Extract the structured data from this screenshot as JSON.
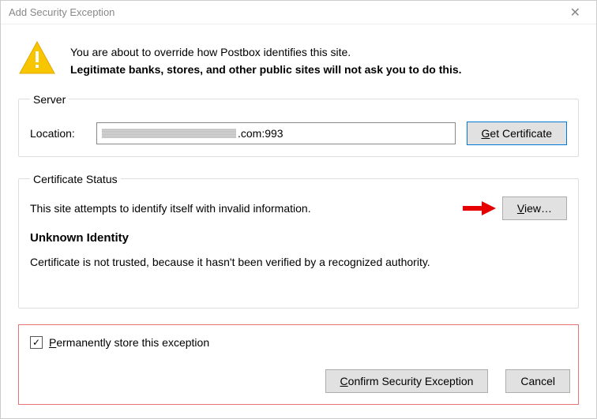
{
  "window": {
    "title": "Add Security Exception"
  },
  "intro": {
    "line1": "You are about to override how Postbox identifies this site.",
    "line2": "Legitimate banks, stores, and other public sites will not ask you to do this."
  },
  "server": {
    "legend": "Server",
    "location_label": "Location:",
    "location_suffix": ".com:993",
    "get_certificate_label": "Get Certificate",
    "get_certificate_accesskey": "G"
  },
  "cert": {
    "legend": "Certificate Status",
    "attempt_text": "This site attempts to identify itself with invalid information.",
    "view_label": "View…",
    "view_accesskey": "V",
    "headline": "Unknown Identity",
    "detail": "Certificate is not trusted, because it hasn't been verified by a recognized authority."
  },
  "footer": {
    "perm_label": "Permanently store this exception",
    "perm_accesskey": "P",
    "perm_checked": true,
    "confirm_label": "Confirm Security Exception",
    "confirm_accesskey": "C",
    "cancel_label": "Cancel"
  }
}
